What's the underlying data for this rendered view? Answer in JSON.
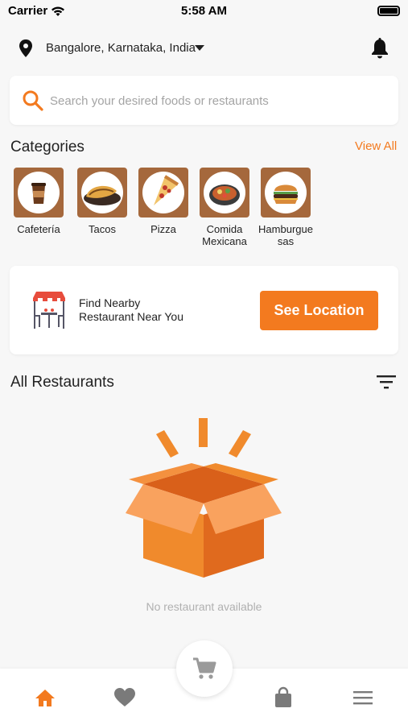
{
  "status_bar": {
    "carrier": "Carrier",
    "time": "5:58 AM"
  },
  "location": {
    "text": "Bangalore, Karnataka, India",
    "icon": "location-pin-icon"
  },
  "notifications": {
    "icon": "bell-icon"
  },
  "search": {
    "placeholder": "Search your desired foods or restaurants",
    "value": "",
    "icon": "search-icon"
  },
  "categories": {
    "title": "Categories",
    "view_all": "View All",
    "items": [
      {
        "label": "Cafetería",
        "icon": "coffee-cup-icon"
      },
      {
        "label": "Tacos",
        "icon": "tacos-icon"
      },
      {
        "label": "Pizza",
        "icon": "pizza-icon"
      },
      {
        "label": "Comida Mexicana",
        "icon": "mexican-food-icon"
      },
      {
        "label": "Hamburgue sas",
        "icon": "hamburger-icon"
      }
    ]
  },
  "nearby": {
    "line1": "Find Nearby",
    "line2": "Restaurant Near You",
    "button": "See Location",
    "icon": "restaurant-table-icon"
  },
  "restaurants": {
    "title": "All Restaurants",
    "empty_text": "No restaurant available",
    "filter_icon": "filter-icon"
  },
  "bottom_nav": {
    "items": [
      {
        "icon": "home-icon",
        "active": true
      },
      {
        "icon": "heart-icon",
        "active": false
      },
      {
        "icon": "cart-icon",
        "active": false
      },
      {
        "icon": "shopping-bag-icon",
        "active": false
      },
      {
        "icon": "menu-icon",
        "active": false
      }
    ]
  },
  "colors": {
    "accent": "#f37a1f",
    "category_tile": "#a5683c",
    "icon_gray": "#7a7a7a"
  }
}
